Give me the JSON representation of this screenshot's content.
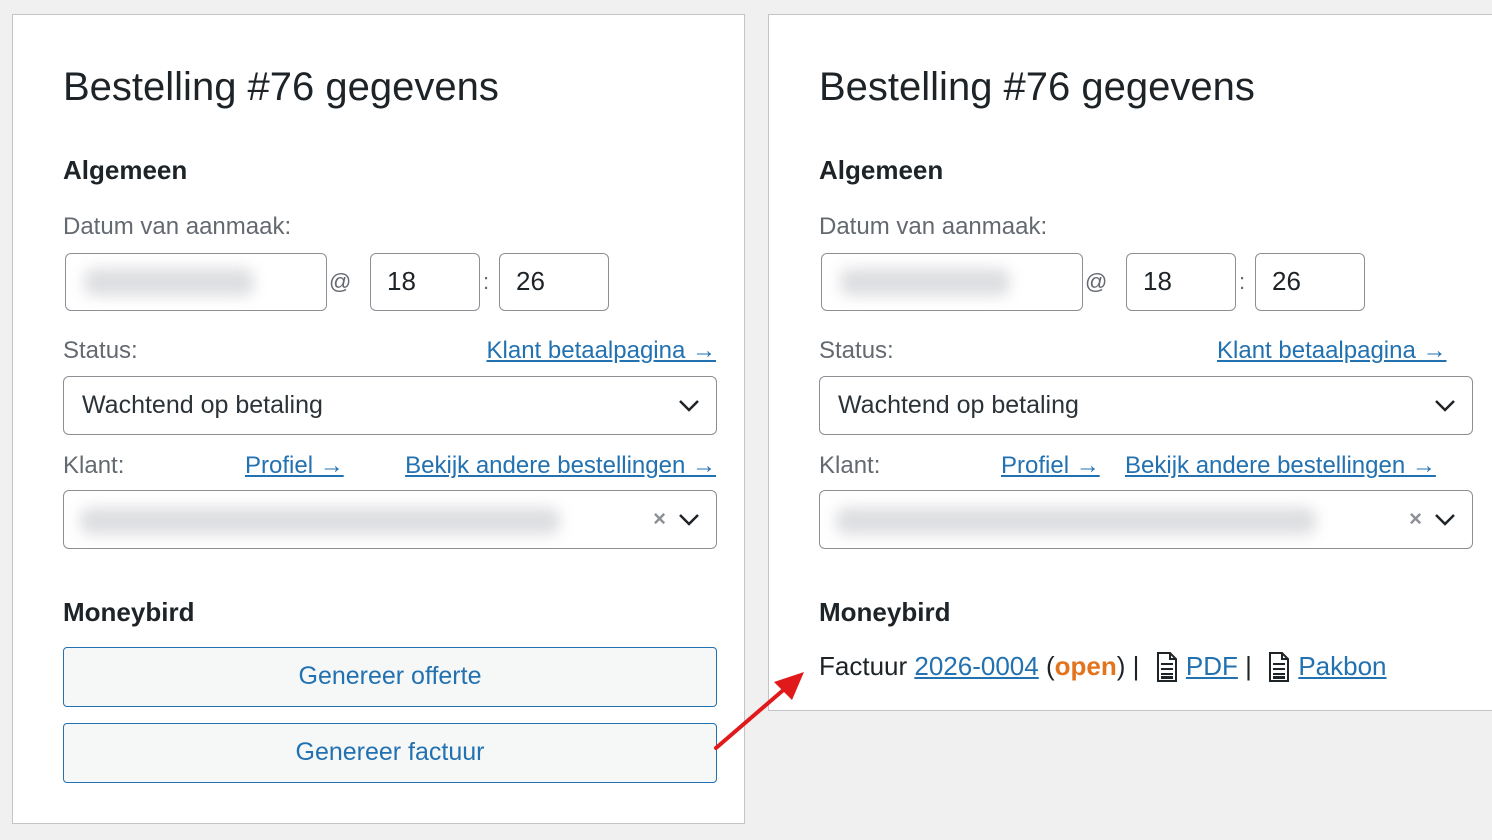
{
  "left": {
    "title": "Bestelling #76 gegevens",
    "section_general": "Algemeen",
    "date_label": "Datum van aanmaak:",
    "at_sign": "@",
    "hour": "18",
    "colon": ":",
    "minute": "26",
    "status_label": "Status:",
    "status_link": "Klant betaalpagina →",
    "status_value": "Wachtend op betaling",
    "customer_label": "Klant:",
    "profile_link": "Profiel →",
    "orders_link": "Bekijk andere bestellingen →",
    "clear_symbol": "×",
    "section_moneybird": "Moneybird",
    "btn_quote": "Genereer offerte",
    "btn_invoice": "Genereer factuur"
  },
  "right": {
    "title": "Bestelling #76 gegevens",
    "section_general": "Algemeen",
    "date_label": "Datum van aanmaak:",
    "at_sign": "@",
    "hour": "18",
    "colon": ":",
    "minute": "26",
    "status_label": "Status:",
    "status_link": "Klant betaalpagina →",
    "status_value": "Wachtend op betaling",
    "customer_label": "Klant:",
    "profile_link": "Profiel →",
    "orders_link": "Bekijk andere bestellingen →",
    "clear_symbol": "×",
    "section_moneybird": "Moneybird",
    "invoice_prefix": "Factuur",
    "invoice_number": "2026-0004",
    "paren_open": "(",
    "invoice_status": "open",
    "paren_close": ")",
    "pipe": "|",
    "pdf_link": "PDF",
    "packing_link": "Pakbon"
  },
  "icons": {
    "chevron": "chevron-down-icon",
    "clear": "clear-icon",
    "document": "document-icon",
    "arrow": "red-arrow"
  },
  "colors": {
    "link": "#2271b1",
    "open_status": "#e3741e",
    "arrow": "#e0191b"
  }
}
